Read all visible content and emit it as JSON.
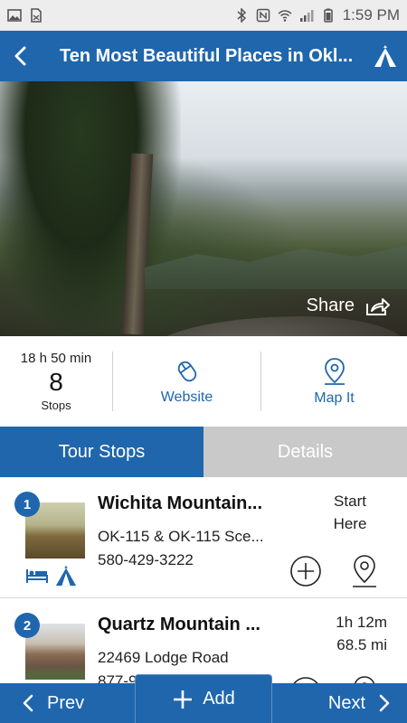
{
  "status_bar": {
    "time": "1:59 PM",
    "left_icons": [
      "image-icon",
      "document-icon"
    ],
    "right_icons": [
      "bluetooth-icon",
      "nfc-icon",
      "wifi-icon",
      "signal-icon",
      "battery-icon"
    ]
  },
  "header": {
    "title": "Ten Most Beautiful Places in Okl...",
    "back_icon": "chevron-left-icon",
    "action_icon": "tent-icon"
  },
  "hero": {
    "share_label": "Share",
    "share_icon": "share-arrow-icon"
  },
  "summary": {
    "duration": "18 h 50 min",
    "stops_count": "8",
    "stops_label": "Stops",
    "website_label": "Website",
    "map_it_label": "Map It"
  },
  "tabs": [
    {
      "label": "Tour Stops",
      "active": true
    },
    {
      "label": "Details",
      "active": false
    }
  ],
  "stops": [
    {
      "number": "1",
      "name": "Wichita Mountain...",
      "address": "OK-115 & OK-115 Sce...",
      "phone": "580-429-3222",
      "meta_line1": "Start",
      "meta_line2": "Here",
      "amenities": [
        "bed-icon",
        "tent-icon"
      ]
    },
    {
      "number": "2",
      "name": "Quartz Mountain ...",
      "address": "22469 Lodge Road",
      "phone": "877-9",
      "meta_line1": "1h 12m",
      "meta_line2": "68.5 mi",
      "amenities": []
    }
  ],
  "bottom_bar": {
    "prev_label": "Prev",
    "add_label": "Add",
    "next_label": "Next"
  },
  "colors": {
    "primary": "#1f66ad",
    "inactive_tab": "#c9c9c9",
    "status_bar": "#ededed"
  }
}
